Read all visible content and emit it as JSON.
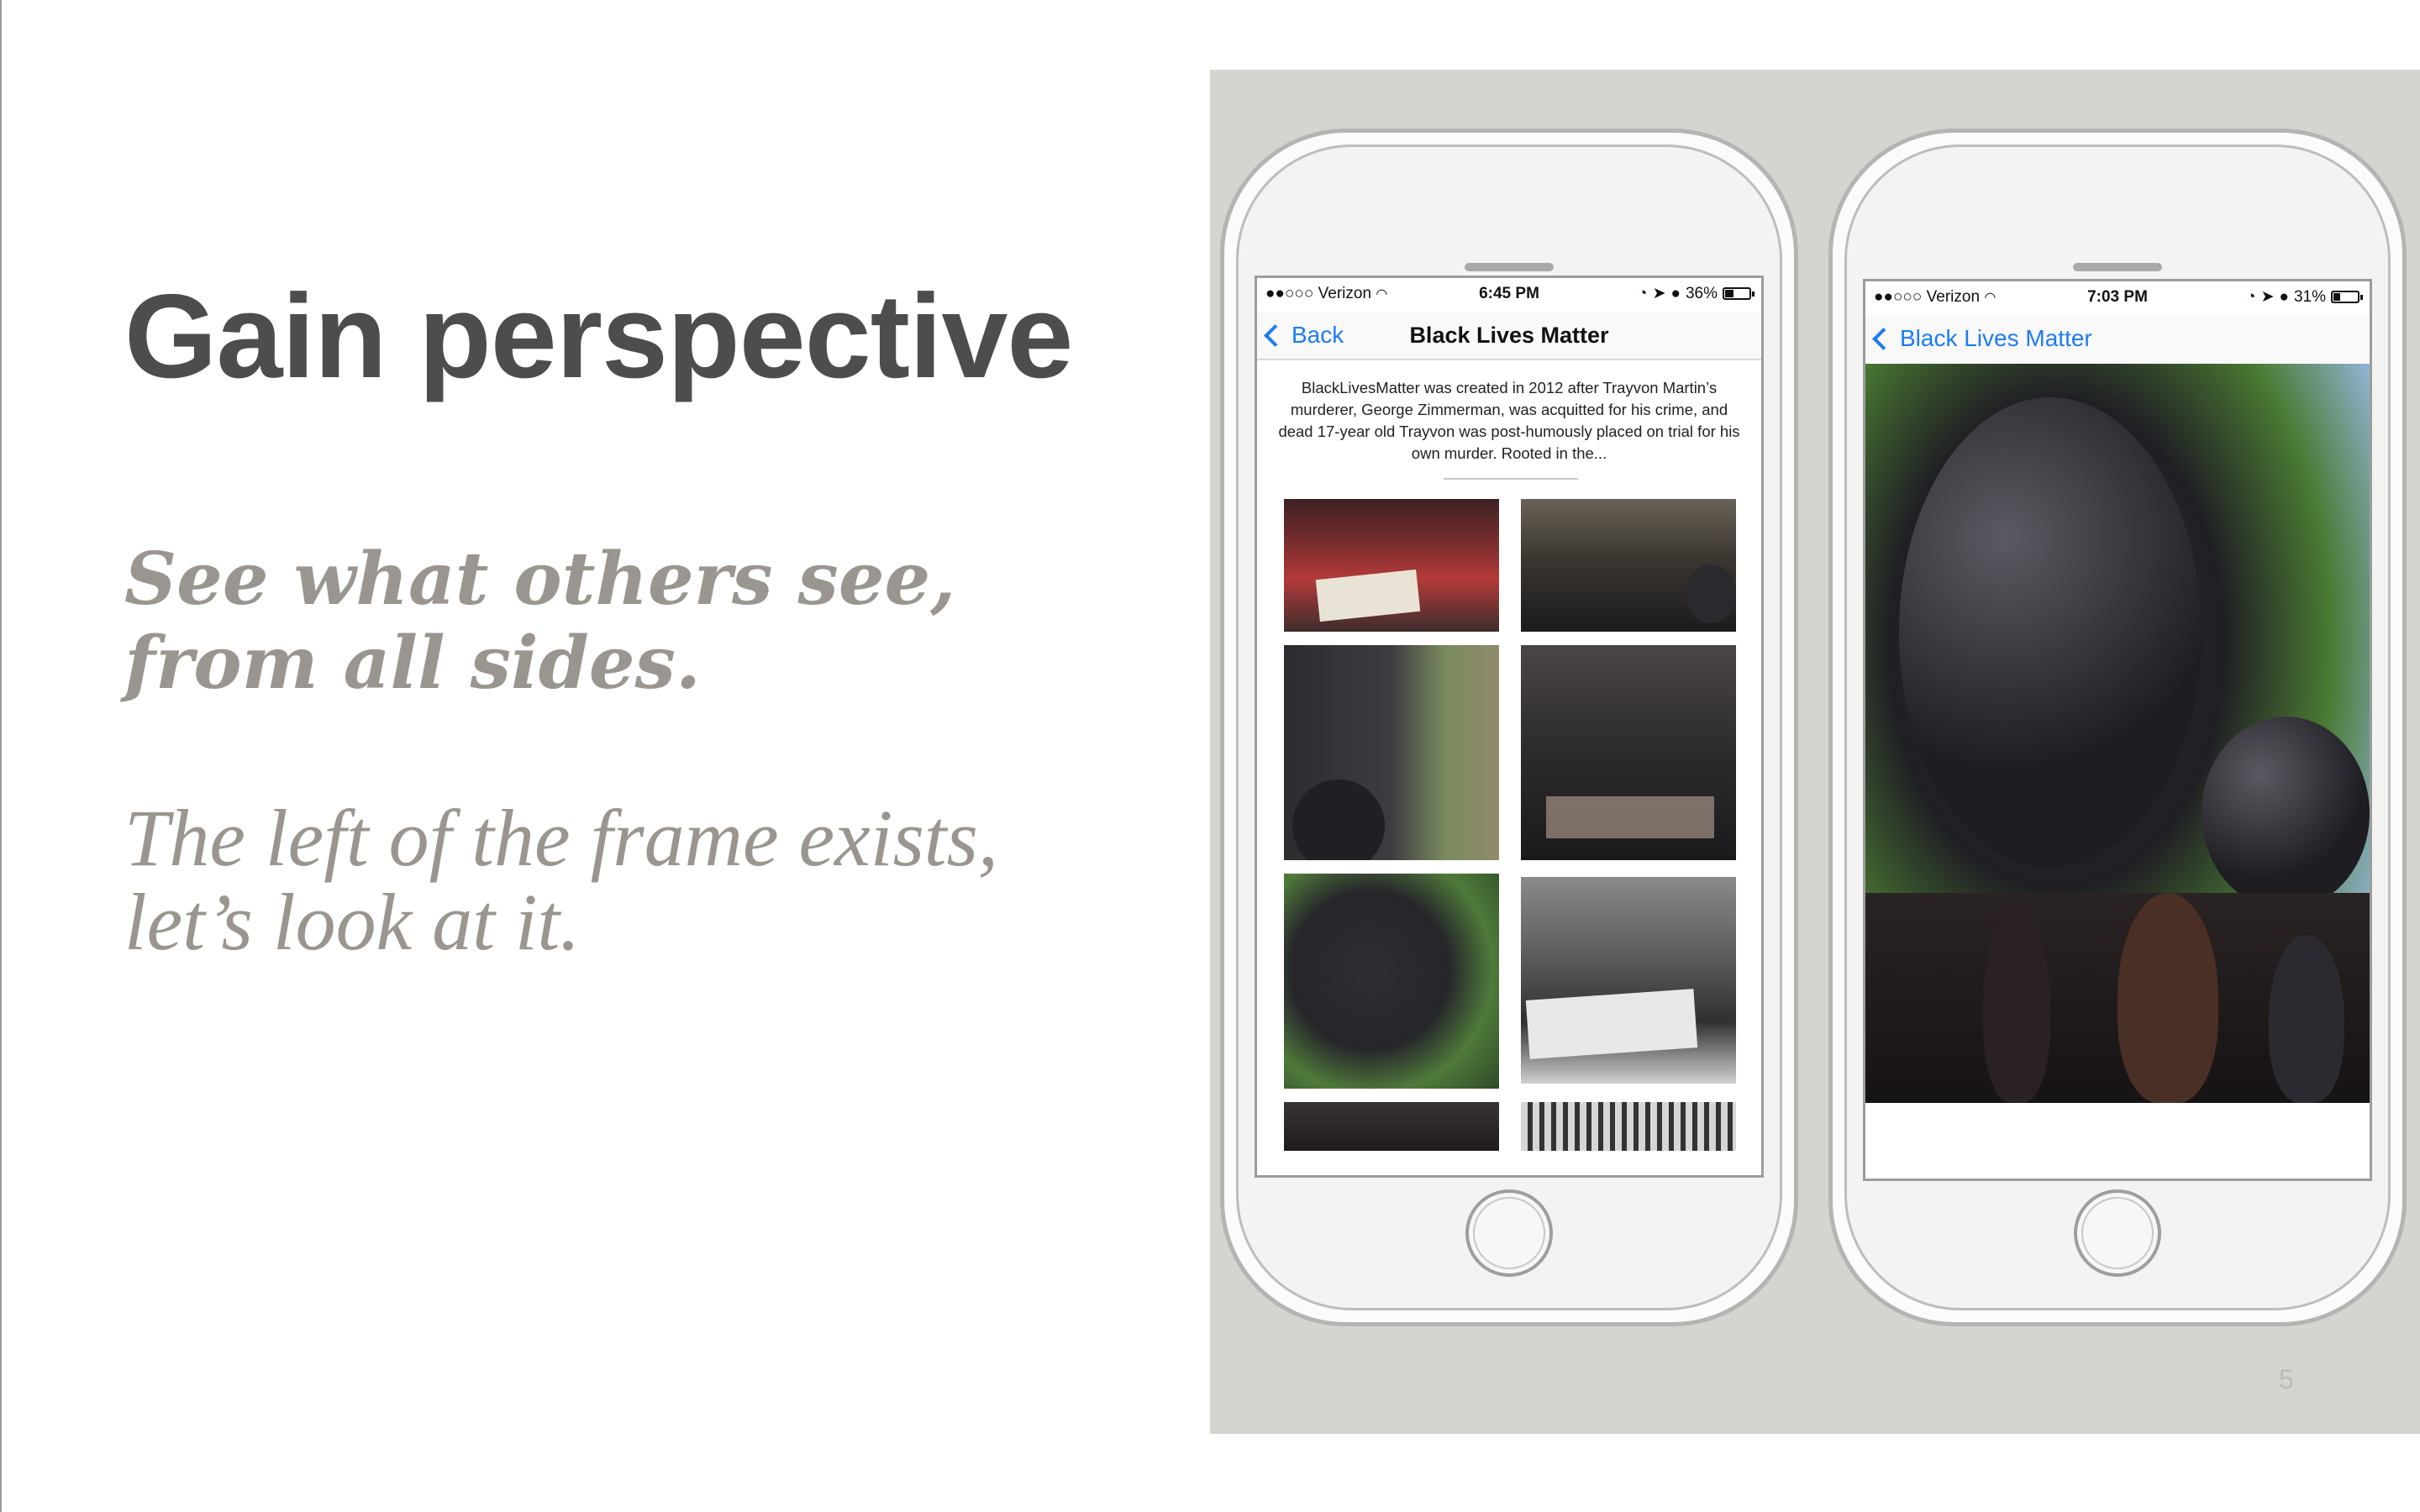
{
  "slide": {
    "title": "Gain perspective",
    "subtitle_line1": "See what others see,",
    "subtitle_line2": "from all sides.",
    "body_line1": "The left of the frame exists,",
    "body_line2": "let’s look at it.",
    "page_number": "5"
  },
  "phone_left": {
    "status": {
      "carrier": "●●○○○ Verizon",
      "time": "6:45 PM",
      "battery": "36%"
    },
    "nav": {
      "back_label": "Back",
      "title": "Black Lives Matter"
    },
    "description": "BlackLivesMatter was created in 2012 after Trayvon Martin’s murderer, George Zimmerman, was acquitted for his crime, and dead 17-year old Trayvon was post-humously placed on trial for his own murder. Rooted in the..."
  },
  "phone_right": {
    "status": {
      "carrier": "●●○○○ Verizon",
      "time": "7:03 PM",
      "battery": "31%"
    },
    "nav": {
      "back_label": "Black Lives Matter"
    }
  },
  "icons": [
    "wifi-icon",
    "location-arrow-icon",
    "alarm-icon",
    "rotation-lock-icon",
    "battery-icon",
    "chevron-left-icon"
  ],
  "colors": {
    "accent_blue": "#1d7cf2",
    "title_gray": "#4d4d4d",
    "subtitle_gray": "#9a968f",
    "panel_bg": "#d6d4ce"
  }
}
